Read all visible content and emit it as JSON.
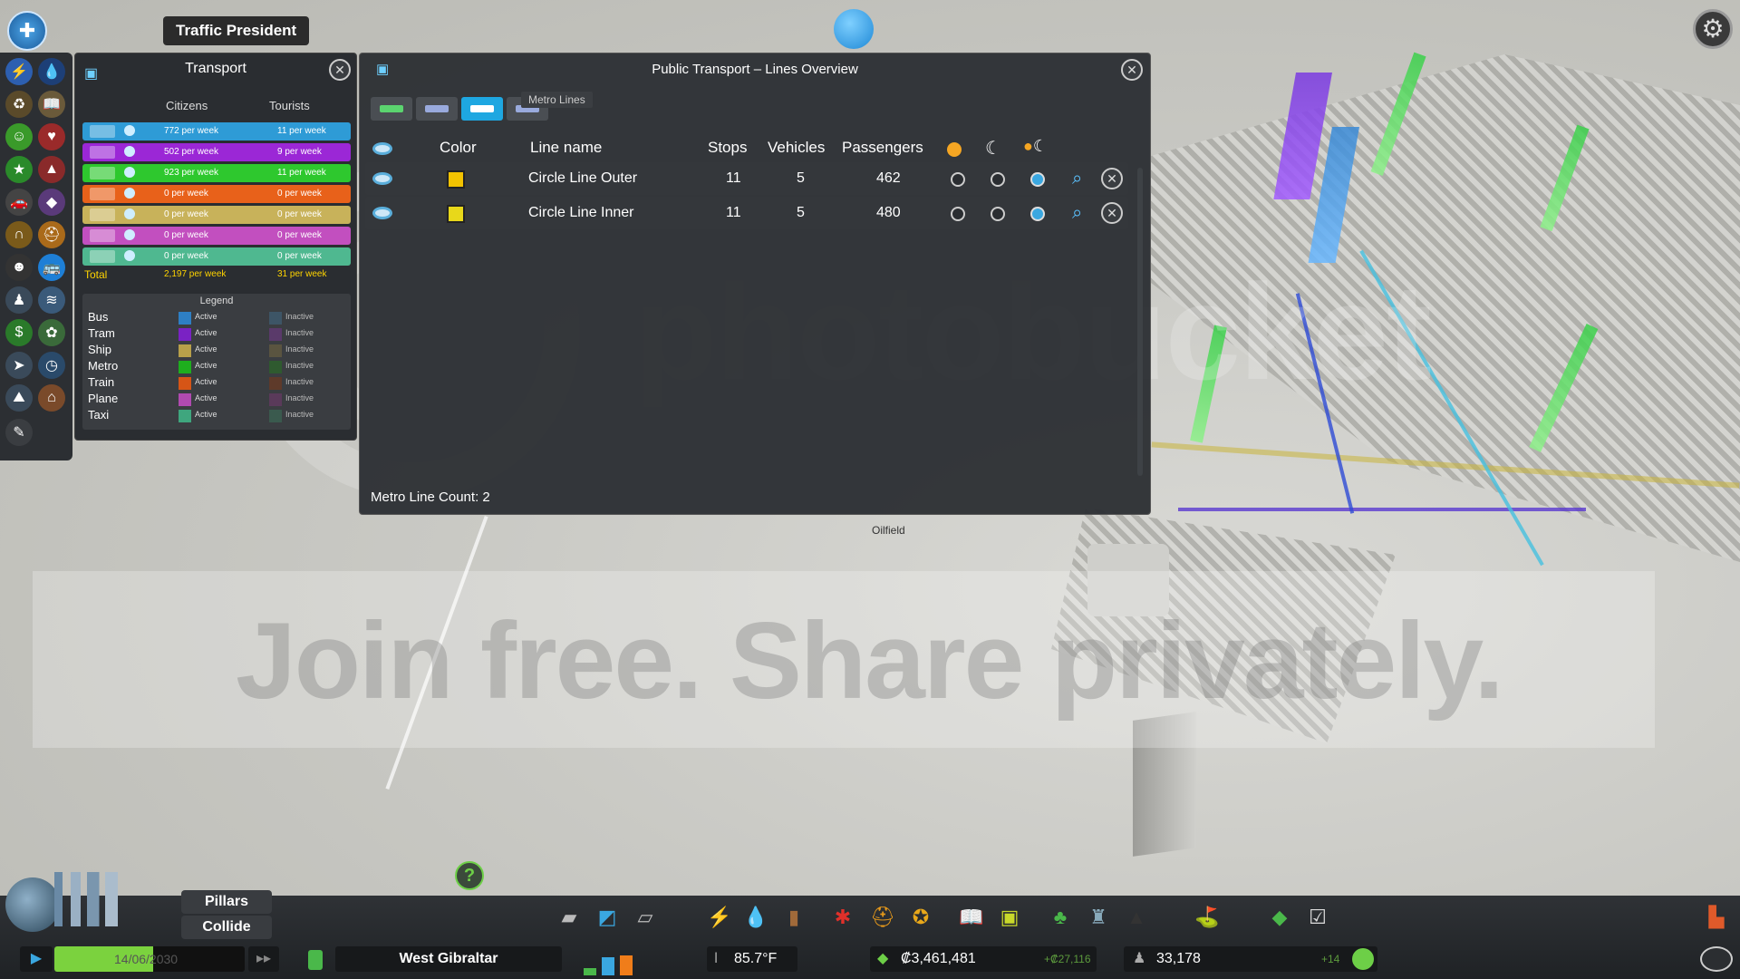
{
  "top": {
    "city_title": "Traffic President"
  },
  "transport_panel": {
    "title": "Transport",
    "col_citizens": "Citizens",
    "col_tourists": "Tourists",
    "rows": [
      {
        "mode": "bus",
        "color": "#2e9bd6",
        "citizens": "772 per week",
        "tourists": "11 per week"
      },
      {
        "mode": "tram",
        "color": "#9b27d6",
        "citizens": "502 per week",
        "tourists": "9 per week"
      },
      {
        "mode": "metro",
        "color": "#2ec82e",
        "citizens": "923 per week",
        "tourists": "11 per week"
      },
      {
        "mode": "train",
        "color": "#e8611a",
        "citizens": "0 per week",
        "tourists": "0 per week"
      },
      {
        "mode": "plane",
        "color": "#c8b25a",
        "citizens": "0 per week",
        "tourists": "0 per week"
      },
      {
        "mode": "ship",
        "color": "#c24fbf",
        "citizens": "0 per week",
        "tourists": "0 per week"
      },
      {
        "mode": "taxi",
        "color": "#4fb890",
        "citizens": "0 per week",
        "tourists": "0 per week"
      }
    ],
    "total_label": "Total",
    "total_citizens": "2,197 per week",
    "total_tourists": "31 per week",
    "legend_title": "Legend",
    "legend": [
      {
        "name": "Bus",
        "active": "Active",
        "inactive": "Inactive",
        "color": "#2e7fc4",
        "inactive_color": "#3d5566"
      },
      {
        "name": "Tram",
        "active": "Active",
        "inactive": "Inactive",
        "color": "#7a22c4",
        "inactive_color": "#5a3a6a"
      },
      {
        "name": "Ship",
        "active": "Active",
        "inactive": "Inactive",
        "color": "#b8a04a",
        "inactive_color": "#5a5440"
      },
      {
        "name": "Metro",
        "active": "Active",
        "inactive": "Inactive",
        "color": "#1eae1e",
        "inactive_color": "#2f5a2f"
      },
      {
        "name": "Train",
        "active": "Active",
        "inactive": "Inactive",
        "color": "#d65516",
        "inactive_color": "#5e3a2a"
      },
      {
        "name": "Plane",
        "active": "Active",
        "inactive": "Inactive",
        "color": "#b04ab0",
        "inactive_color": "#5a3a5a"
      },
      {
        "name": "Taxi",
        "active": "Active",
        "inactive": "Inactive",
        "color": "#3fa67e",
        "inactive_color": "#3a5a4e"
      }
    ]
  },
  "lines_panel": {
    "title": "Public Transport – Lines Overview",
    "tab_tooltip": "Metro Lines",
    "headers": {
      "color": "Color",
      "line_name": "Line name",
      "stops": "Stops",
      "vehicles": "Vehicles",
      "passengers": "Passengers"
    },
    "lines": [
      {
        "name": "Circle Line Outer",
        "color": "#f2c200",
        "stops": "11",
        "vehicles": "5",
        "passengers": "462",
        "schedule": "day-night"
      },
      {
        "name": "Circle Line Inner",
        "color": "#e8d81a",
        "stops": "11",
        "vehicles": "5",
        "passengers": "480",
        "schedule": "day-night"
      }
    ],
    "count_text": "Metro Line Count: 2"
  },
  "map": {
    "label_oilfield": "Oilfield"
  },
  "bottom": {
    "district_buttons": [
      "Pillars",
      "Collide"
    ],
    "help": "?",
    "date": "14/06/2030",
    "district_name": "West Gibraltar",
    "temperature": "85.7°F",
    "money": "₡3,461,481",
    "money_delta": "+₡27,116",
    "population": "33,178",
    "population_delta": "+14"
  },
  "watermark": {
    "brand": "photobucket",
    "slogan": "Join free. Share privately."
  }
}
